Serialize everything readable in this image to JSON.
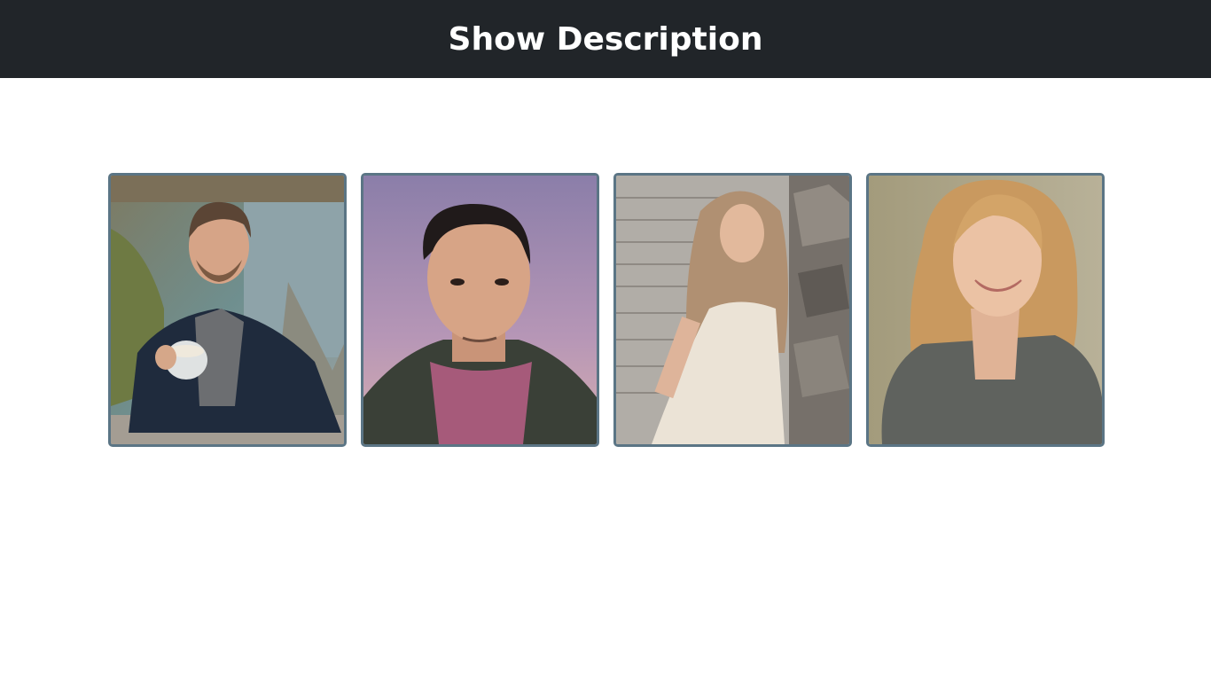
{
  "header": {
    "title": "Show Description"
  },
  "cards": [
    {
      "subject": "man-holding-coffee-cup-by-river-photo"
    },
    {
      "subject": "young-man-portrait-purple-backdrop-photo"
    },
    {
      "subject": "woman-in-white-dress-by-stone-wall-photo"
    },
    {
      "subject": "smiling-blonde-woman-outdoors-photo"
    }
  ],
  "colors": {
    "header_bg": "#212529",
    "header_text": "#ffffff",
    "card_border": "#5b7585",
    "page_bg": "#ffffff"
  }
}
